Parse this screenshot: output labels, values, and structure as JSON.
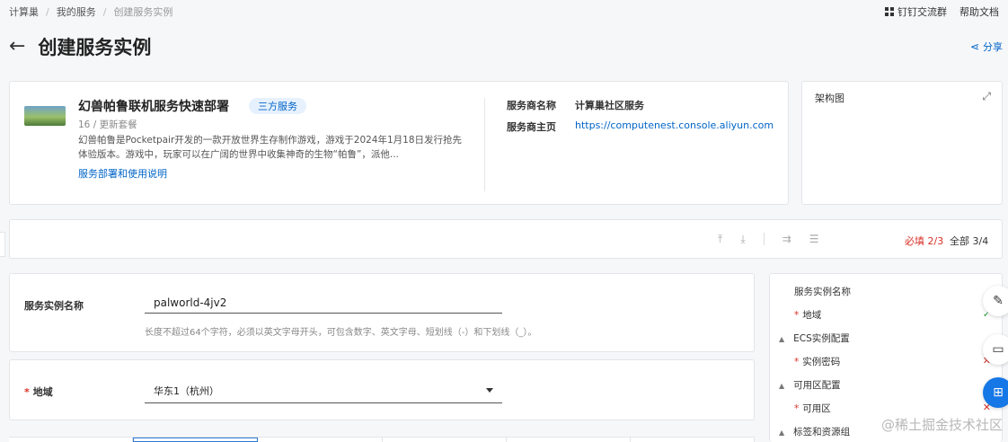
{
  "breadcrumb": {
    "items": [
      "计算巢",
      "我的服务",
      "创建服务实例"
    ],
    "separator": "/"
  },
  "top_links": {
    "dingtalk": "钉钉交流群",
    "help": "帮助文档"
  },
  "page": {
    "title": "创建服务实例",
    "share_label": "分享"
  },
  "service": {
    "name": "幻兽帕鲁联机服务快速部署",
    "badge": "三方服务",
    "meta": "16 / 更新套餐",
    "description": "幻兽帕鲁是Pocketpair开发的一款开放世界生存制作游戏，游戏于2024年1月18日发行抢先体验版本。游戏中，玩家可以在广阔的世界中收集神奇的生物“帕鲁”，派他...",
    "guide_link": "服务部署和使用说明",
    "provider_name_label": "服务商名称",
    "provider_name": "计算巢社区服务",
    "provider_home_label": "服务商主页",
    "provider_home": "https://computenest.console.aliyun.com"
  },
  "architecture": {
    "title": "架构图"
  },
  "progress": {
    "required": "必填 2/3",
    "all": "全部 3/4"
  },
  "form": {
    "instance_name_label": "服务实例名称",
    "instance_name_value": "palworld-4jv2",
    "instance_name_hint": "长度不超过64个字符，必须以英文字母开头，可包含数字、英文字母、短划线（-）和下划线（_）。",
    "region_label": "地域",
    "region_value": "华东1（杭州）"
  },
  "outline": {
    "items": [
      {
        "label": "服务实例名称"
      },
      {
        "label": "地域",
        "required": true,
        "status": "✓"
      },
      {
        "label": "ECS实例配置",
        "group": true
      },
      {
        "label": "实例密码",
        "required": true,
        "status": "✕"
      },
      {
        "label": "可用区配置",
        "group": true
      },
      {
        "label": "可用区",
        "required": true,
        "status": "✕"
      },
      {
        "label": "标签和资源组",
        "group": true
      }
    ]
  },
  "watermark": "@稀土掘金技术社区",
  "colors": {
    "accent": "#0064c8",
    "required": "#d93026",
    "ok": "#2ea043"
  }
}
